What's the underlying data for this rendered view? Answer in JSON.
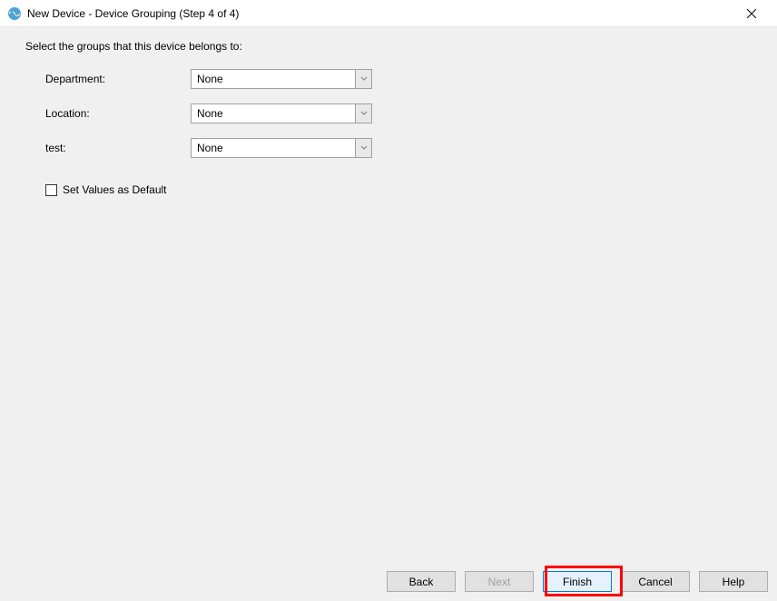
{
  "window": {
    "title": "New Device - Device Grouping (Step 4 of 4)"
  },
  "instruction": "Select the groups that this device belongs to:",
  "fields": {
    "department": {
      "label": "Department:",
      "value": "None"
    },
    "location": {
      "label": "Location:",
      "value": "None"
    },
    "test": {
      "label": "test:",
      "value": "None"
    }
  },
  "checkbox": {
    "label": "Set Values as Default"
  },
  "buttons": {
    "back": "Back",
    "next": "Next",
    "finish": "Finish",
    "cancel": "Cancel",
    "help": "Help"
  }
}
